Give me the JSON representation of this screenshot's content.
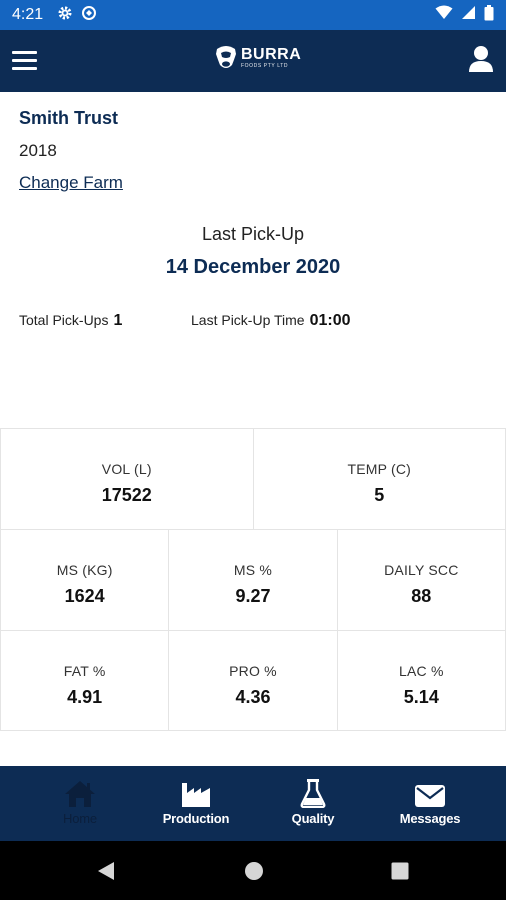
{
  "status_bar": {
    "time": "4:21",
    "icons": [
      "gear-icon",
      "sync-icon",
      "wifi-icon",
      "signal-icon",
      "battery-icon"
    ]
  },
  "app_bar": {
    "logo_text": "BURRA",
    "logo_subtext": "FOODS PTY LTD"
  },
  "farm": {
    "name": "Smith Trust",
    "year": "2018",
    "change_label": "Change Farm"
  },
  "last_pickup": {
    "label": "Last Pick-Up",
    "date": "14 December 2020"
  },
  "stats": {
    "total_label": "Total Pick-Ups",
    "total_value": "1",
    "time_label": "Last Pick-Up Time",
    "time_value": "01:00"
  },
  "metrics": {
    "vol": {
      "label": "VOL (L)",
      "value": "17522"
    },
    "temp": {
      "label": "TEMP (C)",
      "value": "5"
    },
    "ms_kg": {
      "label": "MS (KG)",
      "value": "1624"
    },
    "ms_pct": {
      "label": "MS  %",
      "value": "9.27"
    },
    "daily_scc": {
      "label": "DAILY SCC",
      "value": "88"
    },
    "fat": {
      "label": "FAT  %",
      "value": "4.91"
    },
    "pro": {
      "label": "PRO  %",
      "value": "4.36"
    },
    "lac": {
      "label": "LAC  %",
      "value": "5.14"
    }
  },
  "bottom_nav": {
    "home": "Home",
    "production": "Production",
    "quality": "Quality",
    "messages": "Messages",
    "active": "home"
  },
  "colors": {
    "primary": "#0d2c54",
    "status_bar": "#1565c0",
    "nav_active_label": "#0b1f3c"
  }
}
